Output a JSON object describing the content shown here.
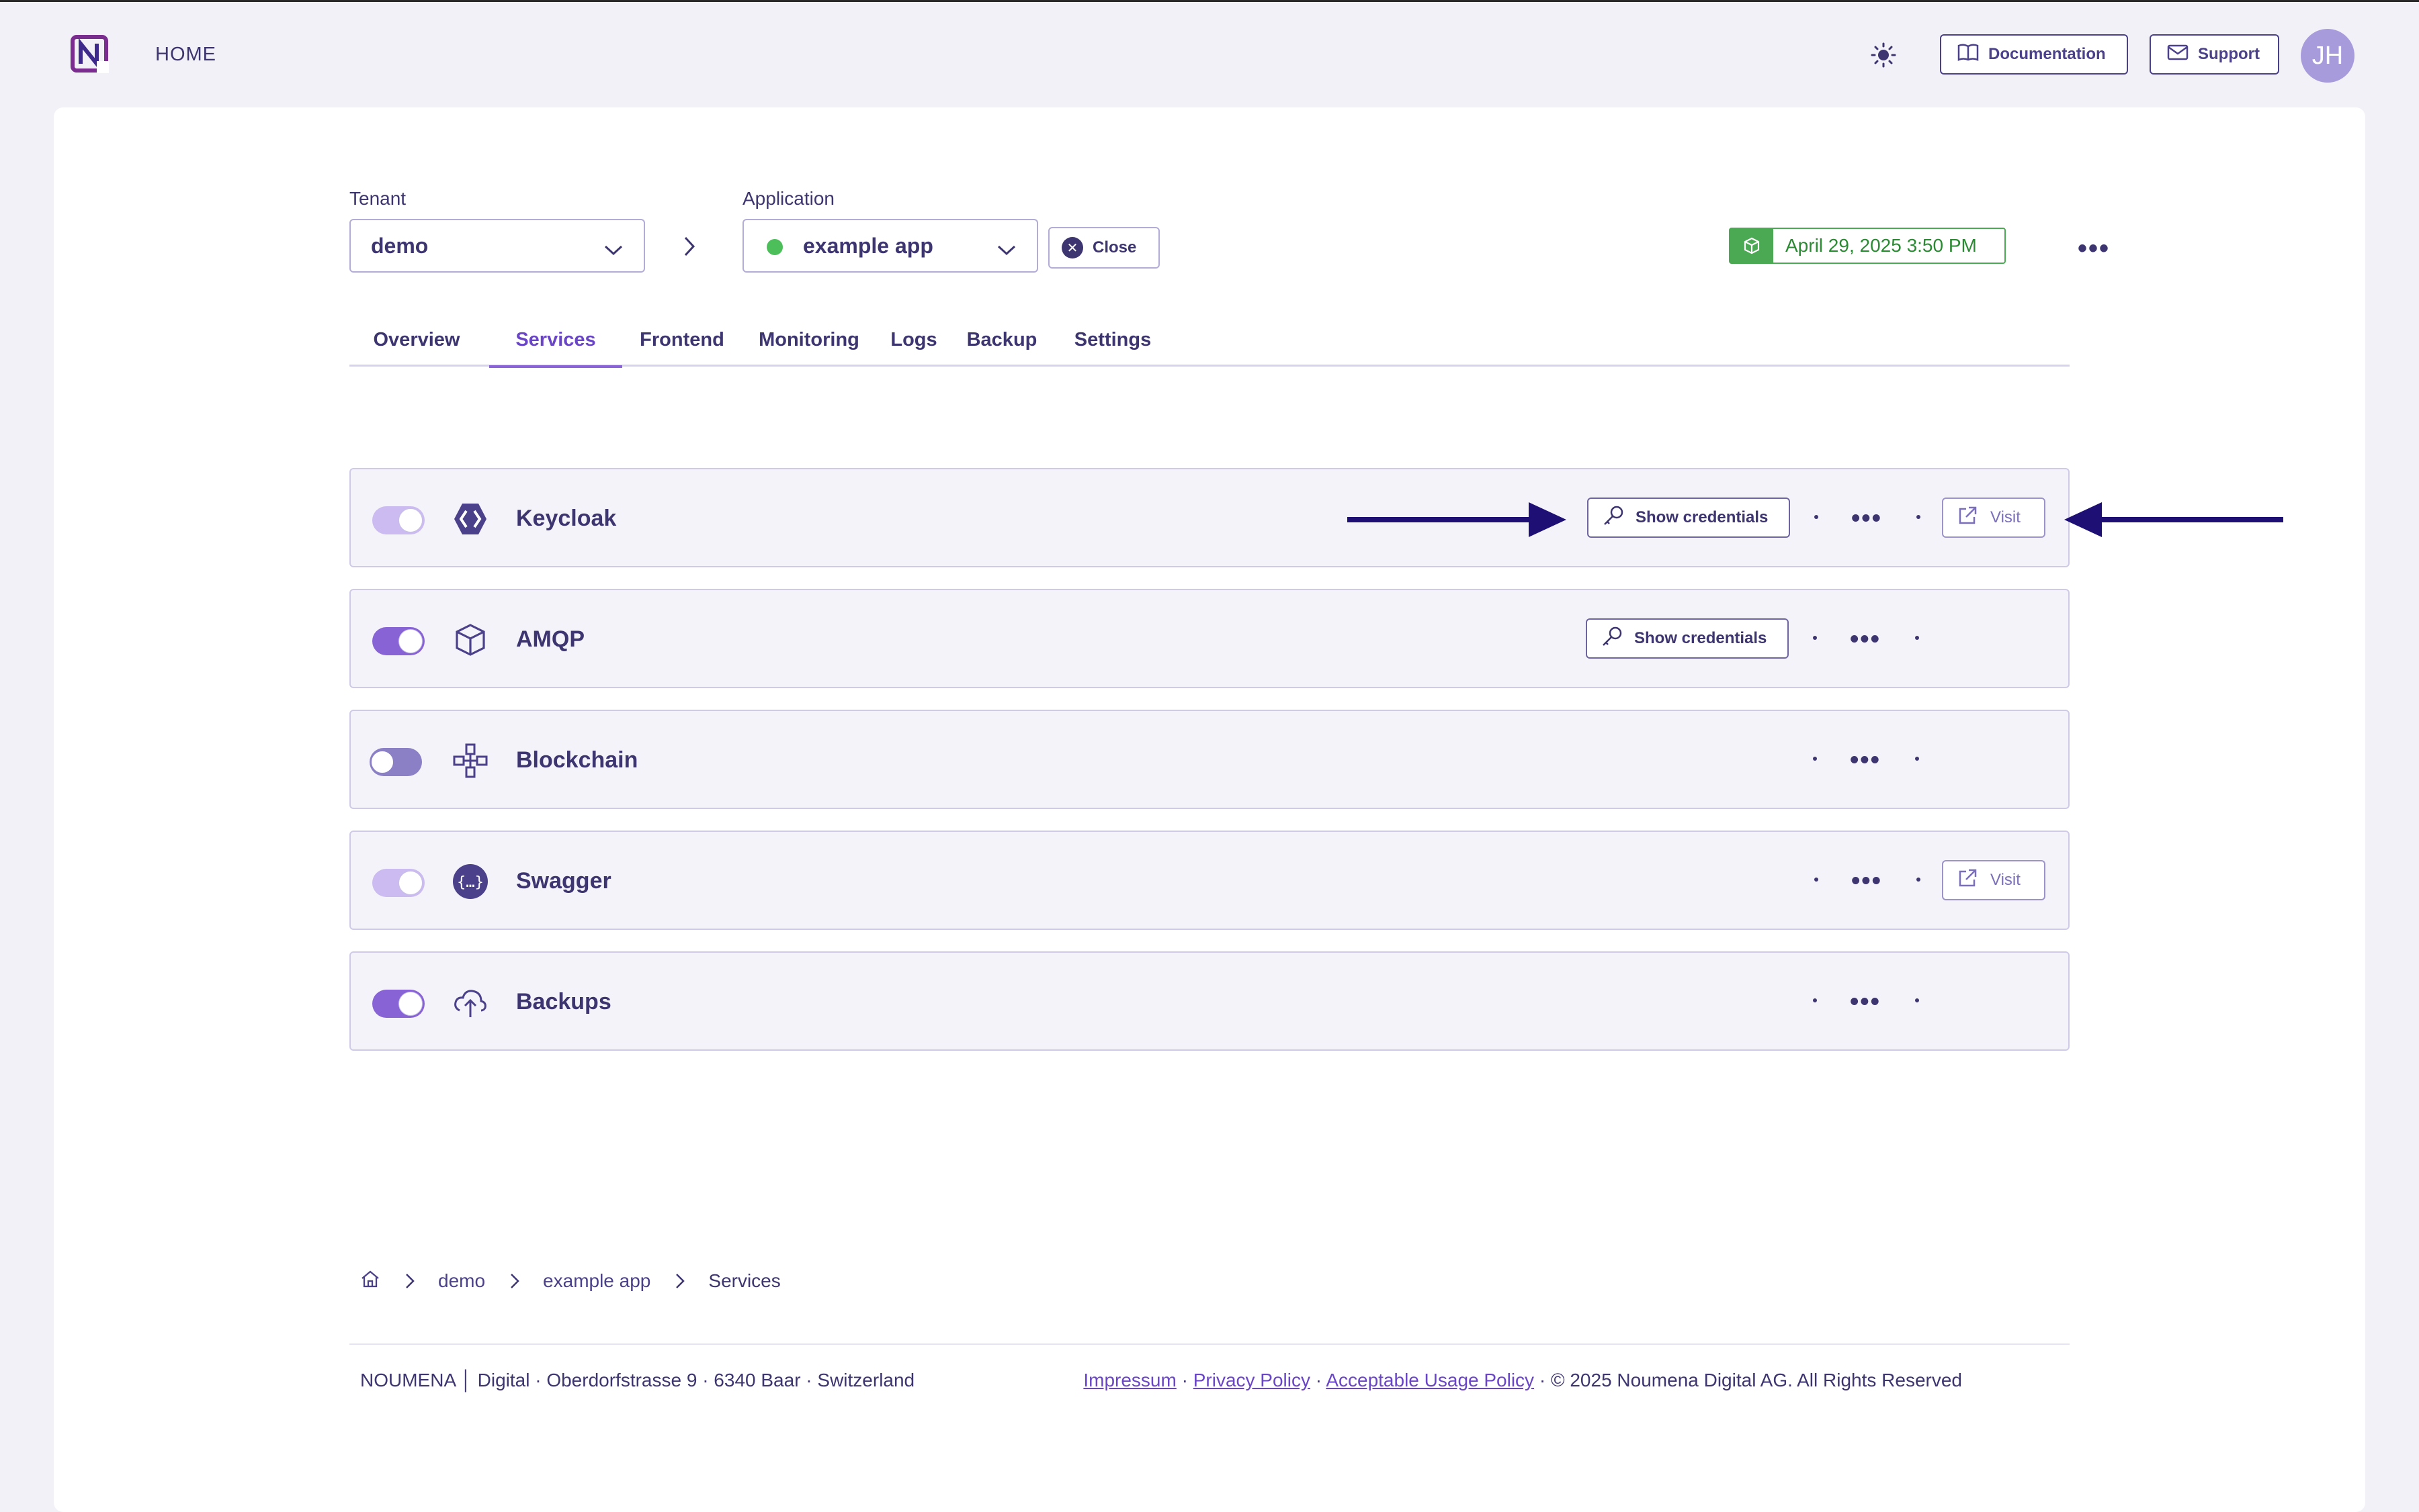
{
  "header": {
    "home_label": "HOME",
    "documentation_label": "Documentation",
    "support_label": "Support",
    "avatar_initials": "JH",
    "icons": {
      "logo": "noumena-logo",
      "theme": "sun-icon",
      "docs": "book-icon",
      "support": "mail-icon"
    }
  },
  "selectors": {
    "tenant_label": "Tenant",
    "tenant_value": "demo",
    "application_label": "Application",
    "application_value": "example app",
    "application_status_color": "#4cbf5a",
    "close_label": "Close",
    "timestamp": "April 29, 2025 3:50 PM",
    "timestamp_color": "#4aa952"
  },
  "tabs": [
    {
      "label": "Overview",
      "active": false
    },
    {
      "label": "Services",
      "active": true
    },
    {
      "label": "Frontend",
      "active": false
    },
    {
      "label": "Monitoring",
      "active": false
    },
    {
      "label": "Logs",
      "active": false
    },
    {
      "label": "Backup",
      "active": false
    },
    {
      "label": "Settings",
      "active": false
    }
  ],
  "services": [
    {
      "name": "Keycloak",
      "icon": "keycloak-icon",
      "toggle": "on-disabled",
      "credentials_label": "Show credentials",
      "visit_label": "Visit"
    },
    {
      "name": "AMQP",
      "icon": "cube-icon",
      "toggle": "on",
      "credentials_label": "Show credentials"
    },
    {
      "name": "Blockchain",
      "icon": "blockchain-icon",
      "toggle": "off"
    },
    {
      "name": "Swagger",
      "icon": "swagger-icon",
      "toggle": "on-disabled",
      "visit_label": "Visit"
    },
    {
      "name": "Backups",
      "icon": "cloud-upload-icon",
      "toggle": "on"
    }
  ],
  "breadcrumb": {
    "home_icon": "home-icon",
    "items": [
      "demo",
      "example app",
      "Services"
    ]
  },
  "footer": {
    "address": "NOUMENA │ Digital · Oberdorfstrasse 9 · 6340 Baar · Switzerland",
    "impressum": "Impressum",
    "privacy": "Privacy Policy",
    "aup": "Acceptable Usage Policy",
    "sep": "·",
    "copyright": "· © 2025 Noumena Digital AG. All Rights Reserved"
  },
  "colors": {
    "accent": "#8863d6",
    "text": "#3d3570",
    "arrow": "#1d0f73"
  }
}
